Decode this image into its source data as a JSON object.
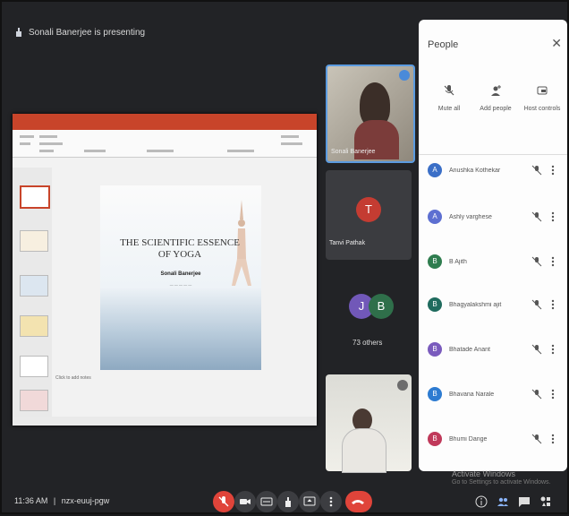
{
  "presenting_banner": "Sonali Banerjee is presenting",
  "slide": {
    "title": "THE SCIENTIFIC ESSENCE OF YOGA",
    "presenter": "Sonali Banerjee",
    "notes_placeholder": "Click to add notes"
  },
  "tiles": {
    "presenter_name": "Sonali Banerjee",
    "t_avatar_letter": "T",
    "t_name": "Tanvi Pathak",
    "others_letters": [
      "J",
      "B"
    ],
    "others_label": "73 others"
  },
  "people_panel": {
    "title": "People",
    "close_icon": "close-icon",
    "actions": [
      {
        "label": "Mute all",
        "icon": "mic-off-icon"
      },
      {
        "label": "Add people",
        "icon": "add-person-icon"
      },
      {
        "label": "Host controls",
        "icon": "shield-icon"
      }
    ],
    "participants": [
      {
        "name": "Anushka Kothekar",
        "initial": "A",
        "color": "#3b6fc7"
      },
      {
        "name": "Ashly varghese",
        "initial": "A",
        "color": "#5d6fd1"
      },
      {
        "name": "B Ajith",
        "initial": "B",
        "color": "#2f7d4f"
      },
      {
        "name": "Bhagyalakshmi ajit",
        "initial": "B",
        "color": "#1f6b5e"
      },
      {
        "name": "Bhatade Anant",
        "initial": "B",
        "color": "#7a5bbd"
      },
      {
        "name": "Bhavana Narale",
        "initial": "B",
        "color": "#2d7bd1"
      },
      {
        "name": "Bhumi Dange",
        "initial": "B",
        "color": "#c0395a"
      }
    ]
  },
  "bottom_bar": {
    "time": "11:36 AM",
    "separator": "|",
    "meeting_code": "nzx-euuj-pgw"
  },
  "watermark": {
    "line1": "Activate Windows",
    "line2": "Go to Settings to activate Windows."
  },
  "colors": {
    "end_call": "#e0443a",
    "mic_off": "#e0443a",
    "ppt_accent": "#c8442a"
  }
}
